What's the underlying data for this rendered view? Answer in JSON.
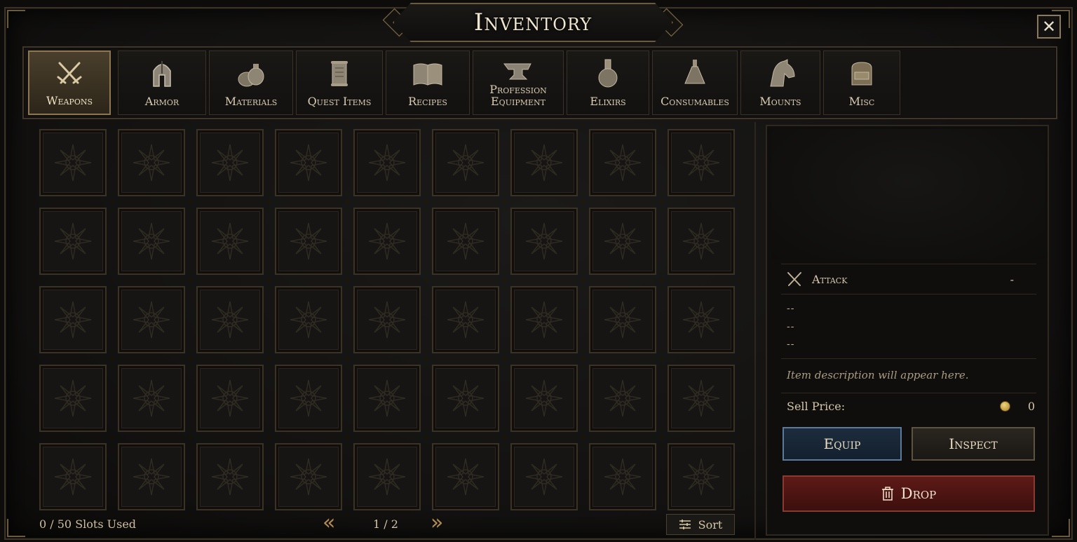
{
  "title": "Inventory",
  "close_label": "✕",
  "tabs": [
    {
      "label": "Weapons",
      "icon": "crossed-swords-icon",
      "active": true
    },
    {
      "label": "Armor",
      "icon": "helmet-icon",
      "active": false
    },
    {
      "label": "Materials",
      "icon": "sacks-icon",
      "active": false
    },
    {
      "label": "Quest Items",
      "icon": "scroll-icon",
      "active": false
    },
    {
      "label": "Recipes",
      "icon": "book-icon",
      "active": false
    },
    {
      "label": "Profession Equipment",
      "icon": "anvil-icon",
      "active": false
    },
    {
      "label": "Elixirs",
      "icon": "flask-icon",
      "active": false
    },
    {
      "label": "Consumables",
      "icon": "potion-icon",
      "active": false
    },
    {
      "label": "Mounts",
      "icon": "horse-head-icon",
      "active": false
    },
    {
      "label": "Misc",
      "icon": "backpack-icon",
      "active": false
    }
  ],
  "grid": {
    "rows": 5,
    "cols": 9,
    "slot_icon": "compass-star-icon"
  },
  "footer": {
    "slots_used": "0 / 50 Slots Used",
    "page": "1 / 2",
    "prev_icon": "double-chevron-left-icon",
    "next_icon": "double-chevron-right-icon",
    "sort_label": "Sort",
    "sort_icon": "sliders-icon"
  },
  "details": {
    "attack_label": "Attack",
    "attack_value": "-",
    "attack_icon": "crossed-swords-icon",
    "stats": [
      "--",
      "--",
      "--"
    ],
    "description": "Item description will appear here.",
    "sell_label": "Sell Price:",
    "sell_value": "0",
    "coin_icon": "gold-coin-icon",
    "equip_label": "Equip",
    "inspect_label": "Inspect",
    "drop_label": "Drop",
    "drop_icon": "trash-icon"
  },
  "colors": {
    "accent_gold": "#b08c54",
    "equip_blue": "#1d2c3d",
    "drop_red": "#5e1a17"
  }
}
